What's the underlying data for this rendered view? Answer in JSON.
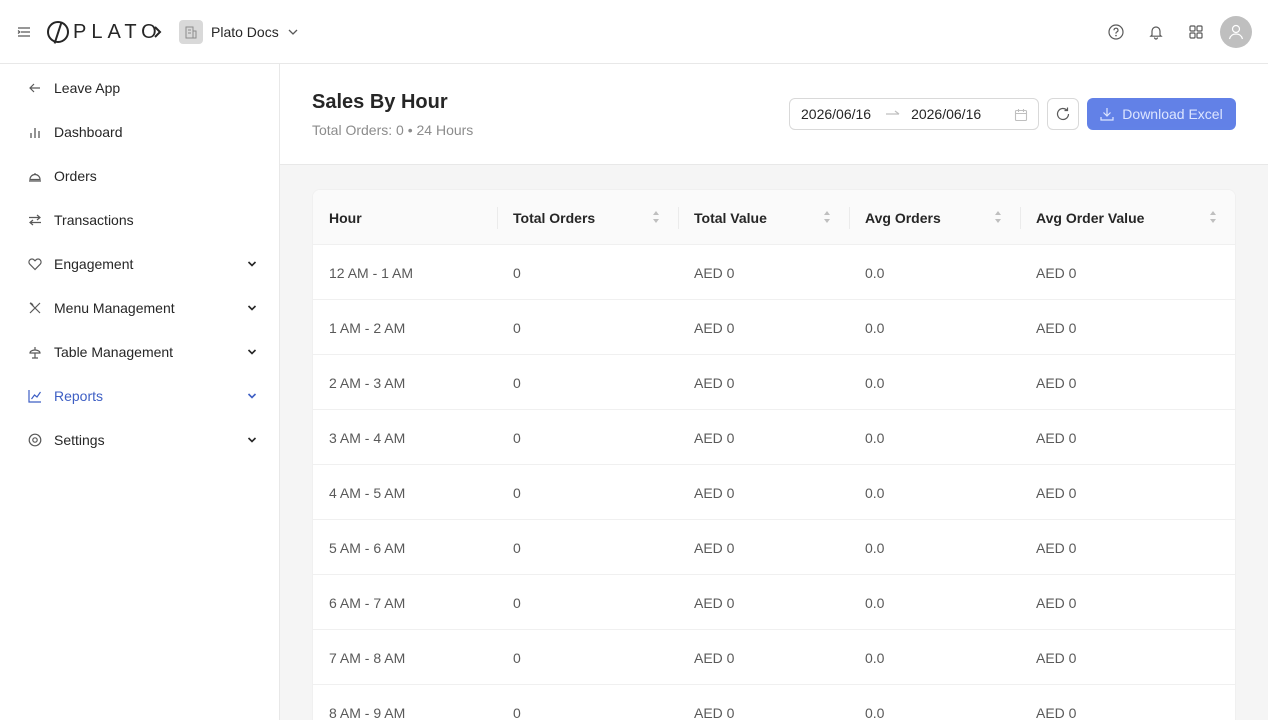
{
  "header": {
    "logo_text": "PLATO",
    "org_name": "Plato Docs"
  },
  "sidebar": {
    "items": [
      {
        "label": "Leave App",
        "icon": "arrow-left-icon"
      },
      {
        "label": "Dashboard",
        "icon": "bar-chart-icon"
      },
      {
        "label": "Orders",
        "icon": "cloche-icon"
      },
      {
        "label": "Transactions",
        "icon": "swap-icon"
      },
      {
        "label": "Engagement",
        "icon": "heart-icon"
      },
      {
        "label": "Menu Management",
        "icon": "utensils-icon"
      },
      {
        "label": "Table Management",
        "icon": "table-icon"
      },
      {
        "label": "Reports",
        "icon": "line-chart-icon"
      },
      {
        "label": "Settings",
        "icon": "gear-icon"
      }
    ]
  },
  "page": {
    "title": "Sales By Hour",
    "subtitle": "Total Orders: 0 • 24 Hours",
    "date_start": "2026/06/16",
    "date_end": "2026/06/16",
    "download_label": "Download Excel"
  },
  "table": {
    "columns": [
      "Hour",
      "Total Orders",
      "Total Value",
      "Avg Orders",
      "Avg Order Value"
    ],
    "rows": [
      [
        "12 AM - 1 AM",
        "0",
        "AED 0",
        "0.0",
        "AED 0"
      ],
      [
        "1 AM - 2 AM",
        "0",
        "AED 0",
        "0.0",
        "AED 0"
      ],
      [
        "2 AM - 3 AM",
        "0",
        "AED 0",
        "0.0",
        "AED 0"
      ],
      [
        "3 AM - 4 AM",
        "0",
        "AED 0",
        "0.0",
        "AED 0"
      ],
      [
        "4 AM - 5 AM",
        "0",
        "AED 0",
        "0.0",
        "AED 0"
      ],
      [
        "5 AM - 6 AM",
        "0",
        "AED 0",
        "0.0",
        "AED 0"
      ],
      [
        "6 AM - 7 AM",
        "0",
        "AED 0",
        "0.0",
        "AED 0"
      ],
      [
        "7 AM - 8 AM",
        "0",
        "AED 0",
        "0.0",
        "AED 0"
      ],
      [
        "8 AM - 9 AM",
        "0",
        "AED 0",
        "0.0",
        "AED 0"
      ]
    ]
  },
  "colors": {
    "accent": "#3e5fc4",
    "primary_button": "#5a7be6"
  }
}
